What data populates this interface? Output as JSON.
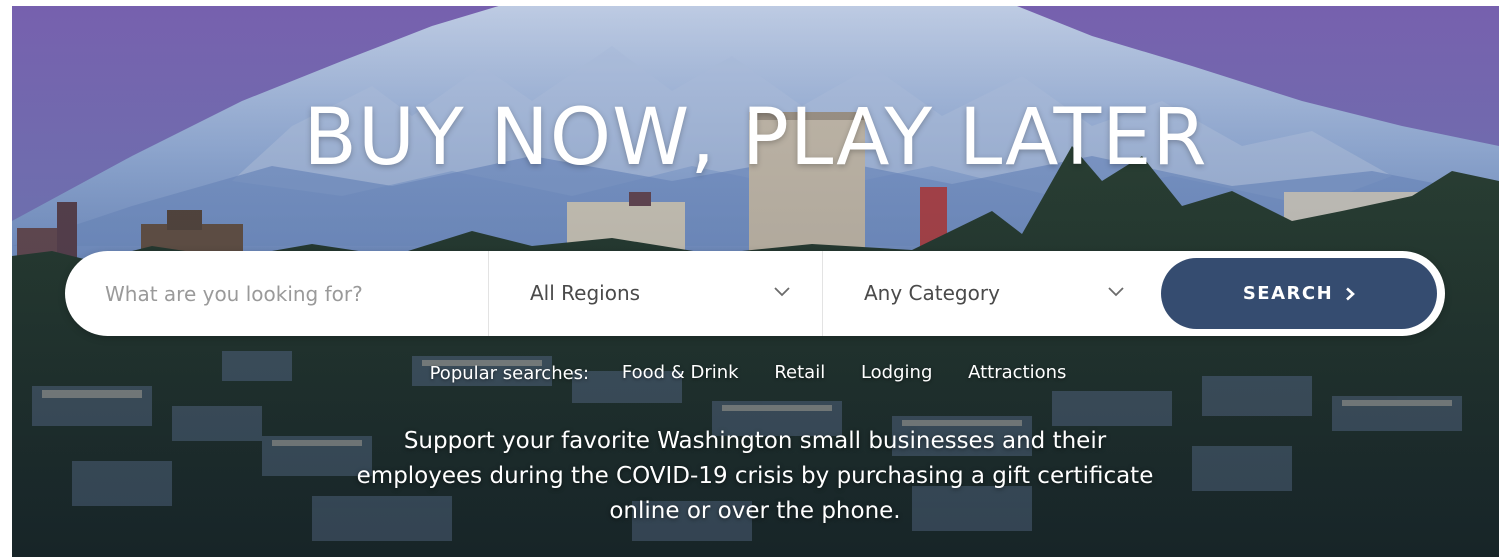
{
  "hero": {
    "headline": "BUY NOW, PLAY LATER",
    "tagline": "Support your favorite Washington small businesses and their employees during the COVID-19 crisis by purchasing a gift certificate online or over the phone."
  },
  "search": {
    "placeholder": "What are you looking for?",
    "value": "",
    "region_select": {
      "selected": "All Regions"
    },
    "category_select": {
      "selected": "Any Category"
    },
    "button_label": "SEARCH",
    "button_icon": "chevron-right-icon"
  },
  "popular_searches": {
    "label": "Popular searches:",
    "links": [
      "Food & Drink",
      "Retail",
      "Lodging",
      "Attractions"
    ]
  },
  "colors": {
    "button": "#354c70",
    "headline_text": "#ffffff",
    "placeholder": "#9a9a9a"
  }
}
